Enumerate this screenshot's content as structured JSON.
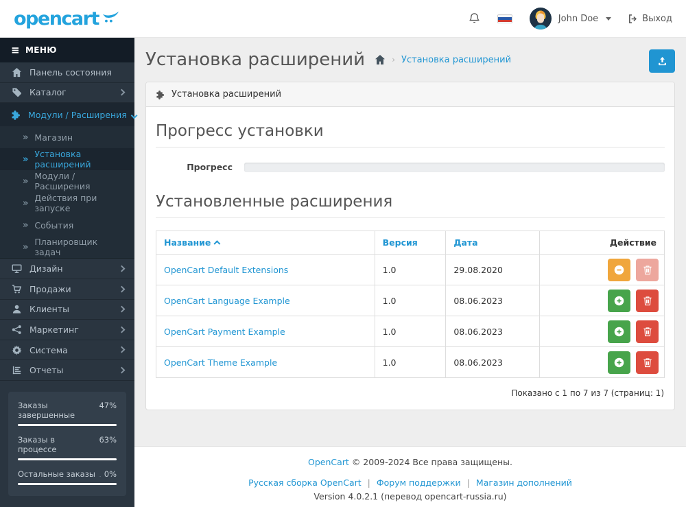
{
  "header": {
    "logo": "opencart",
    "user_name": "John Doe",
    "logout_label": "Выход"
  },
  "sidebar": {
    "menu_title": "МЕНЮ",
    "menu_toggle_glyph": "≡",
    "items": [
      {
        "label": "Панель состояния"
      },
      {
        "label": "Каталог"
      },
      {
        "label": "Модули / Расширения"
      },
      {
        "label": "Дизайн"
      },
      {
        "label": "Продажи"
      },
      {
        "label": "Клиенты"
      },
      {
        "label": "Маркетинг"
      },
      {
        "label": "Система"
      },
      {
        "label": "Отчеты"
      }
    ],
    "submenu_marker": "»",
    "submenu": [
      {
        "label": "Магазин"
      },
      {
        "label": "Установка расширений"
      },
      {
        "label": "Модули / Расширения"
      },
      {
        "label": "Действия при запуске"
      },
      {
        "label": "События"
      },
      {
        "label": "Планировщик задач"
      }
    ],
    "stats": [
      {
        "label": "Заказы завершенные",
        "value": "47%"
      },
      {
        "label": "Заказы в процессе",
        "value": "63%"
      },
      {
        "label": "Остальные заказы",
        "value": "0%"
      }
    ]
  },
  "page": {
    "title": "Установка расширений",
    "breadcrumb_separator": "›",
    "breadcrumb": "Установка расширений"
  },
  "panel": {
    "heading": "Установка расширений",
    "progress_section_title": "Прогресс установки",
    "progress_label": "Прогресс",
    "installed_section_title": "Установленные расширения",
    "pagination": "Показано с 1 по 7 из 7 (страниц: 1)"
  },
  "table": {
    "headers": {
      "name": "Название",
      "version": "Версия",
      "date": "Дата",
      "action": "Действие"
    },
    "rows": [
      {
        "name": "OpenCart Default Extensions",
        "version": "1.0",
        "date": "29.08.2020"
      },
      {
        "name": "OpenCart Language Example",
        "version": "1.0",
        "date": "08.06.2023"
      },
      {
        "name": "OpenCart Payment Example",
        "version": "1.0",
        "date": "08.06.2023"
      },
      {
        "name": "OpenCart Theme Example",
        "version": "1.0",
        "date": "08.06.2023"
      }
    ]
  },
  "footer": {
    "copyright_link": "OpenCart",
    "copyright_text": "© 2009-2024 Все права защищены.",
    "links": [
      {
        "label": "Русская сборка OpenCart"
      },
      {
        "label": "Форум поддержки"
      },
      {
        "label": "Магазин дополнений"
      }
    ],
    "separator": "|",
    "version": "Version 4.0.2.1 (перевод opencart-russia.ru)"
  },
  "colors": {
    "accent_blue": "#2196d3",
    "sidebar_bg": "#2a3540",
    "sidebar_header_bg": "#131c26",
    "success_green": "#47a44b",
    "warning_orange": "#f0a63c",
    "danger_red": "#dd4c3e",
    "danger_red_muted": "#eda79d"
  }
}
